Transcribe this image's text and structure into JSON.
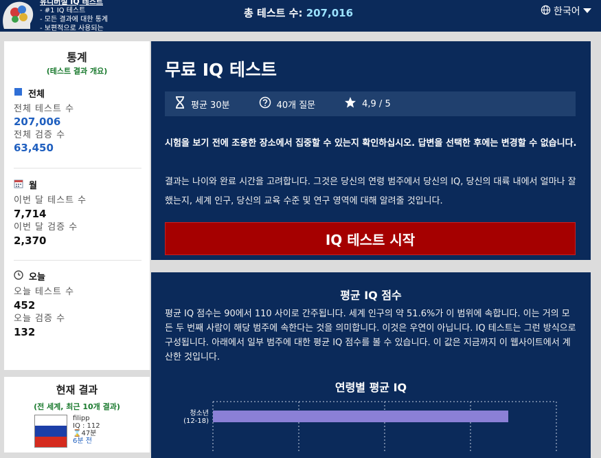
{
  "header": {
    "brand_lines": [
      "유니버설 IQ 테스트",
      "- #1 IQ 테스트",
      "- 모든 결과에 대한 통계",
      "- 보편적으로 사용되는"
    ],
    "total_label": "총 테스트 수:",
    "total_value": "207,016",
    "language": "한국어",
    "icons": {
      "globe": "globe-icon",
      "dropdown": "caret-down-icon",
      "logo": "brain-logo"
    }
  },
  "sidebar": {
    "title": "통계",
    "subtitle": "(테스트 결과 개요)",
    "sections": [
      {
        "icon": "square-icon",
        "title": "전체",
        "rows": [
          {
            "label": "전체 테스트 수",
            "value": "207,006"
          },
          {
            "label": "전체 검증 수",
            "value": "63,450"
          }
        ]
      },
      {
        "icon": "calendar-icon",
        "title": "월",
        "rows": [
          {
            "label": "이번 달 테스트 수",
            "value": "7,714"
          },
          {
            "label": "이번 달 검증 수",
            "value": "2,370"
          }
        ]
      },
      {
        "icon": "clock-icon",
        "title": "오늘",
        "rows": [
          {
            "label": "오늘 테스트 수",
            "value": "452"
          },
          {
            "label": "오늘 검증 수",
            "value": "132"
          }
        ]
      }
    ]
  },
  "current_results": {
    "title": "현재 결과",
    "subtitle": "(전 세계, 최근 10개 결과)",
    "entries": [
      {
        "name": "filipp",
        "iq": "IQ : 112",
        "time": "⌛47분",
        "ago": "6분 전",
        "flag_colors": [
          "#ffffff",
          "#1c3fa8",
          "#d52b1e"
        ]
      }
    ]
  },
  "main": {
    "title": "무료 IQ 테스트",
    "info": [
      {
        "icon": "hourglass-icon",
        "text": "평균 30분"
      },
      {
        "icon": "question-circle-icon",
        "text": "40개 질문"
      },
      {
        "icon": "star-icon",
        "text": "4,9 / 5"
      }
    ],
    "notice_bold": "시험을 보기 전에 조용한 장소에서 집중할 수 있는지 확인하십시오. 답변을 선택한 후에는 변경할 수 없습니다.",
    "notice": "결과는 나이와 완료 시간을 고려합니다. 그것은 당신의 연령 범주에서 당신의 IQ, 당신의 대륙 내에서 얼마나 잘했는지, 세계 인구, 당신의 교육 수준 및 연구 영역에 대해 알려줄 것입니다.",
    "start_button": "IQ 테스트 시작"
  },
  "average": {
    "title": "평균 IQ 점수",
    "text": "평균 IQ 점수는 90에서 110 사이로 간주됩니다. 세계 인구의 약 51.6%가 이 범위에 속합니다. 이는 거의 모든 두 번째 사람이 해당 범주에 속한다는 것을 의미합니다. 이것은 우연이 아닙니다. IQ 테스트는 그런 방식으로 구성됩니다. 아래에서 일부 범주에 대한 평균 IQ 점수를 볼 수 있습니다. 이 값은 지금까지 이 웹사이트에서 계산한 것입니다.",
    "chart_title": "연령별 평균 IQ"
  },
  "chart_data": {
    "type": "bar",
    "orientation": "horizontal",
    "title": "연령별 평균 IQ",
    "categories": [
      "청소년\n(12-18)"
    ],
    "category_lines": [
      [
        "청소년",
        "(12-18)"
      ]
    ],
    "values": [
      0.86
    ],
    "grid": true,
    "bar_color": "#8b80d6"
  },
  "colors": {
    "navy": "#0b2a5a",
    "accent_blue": "#1f5fbf",
    "green": "#1a7a2e",
    "start_red": "#a50000"
  }
}
